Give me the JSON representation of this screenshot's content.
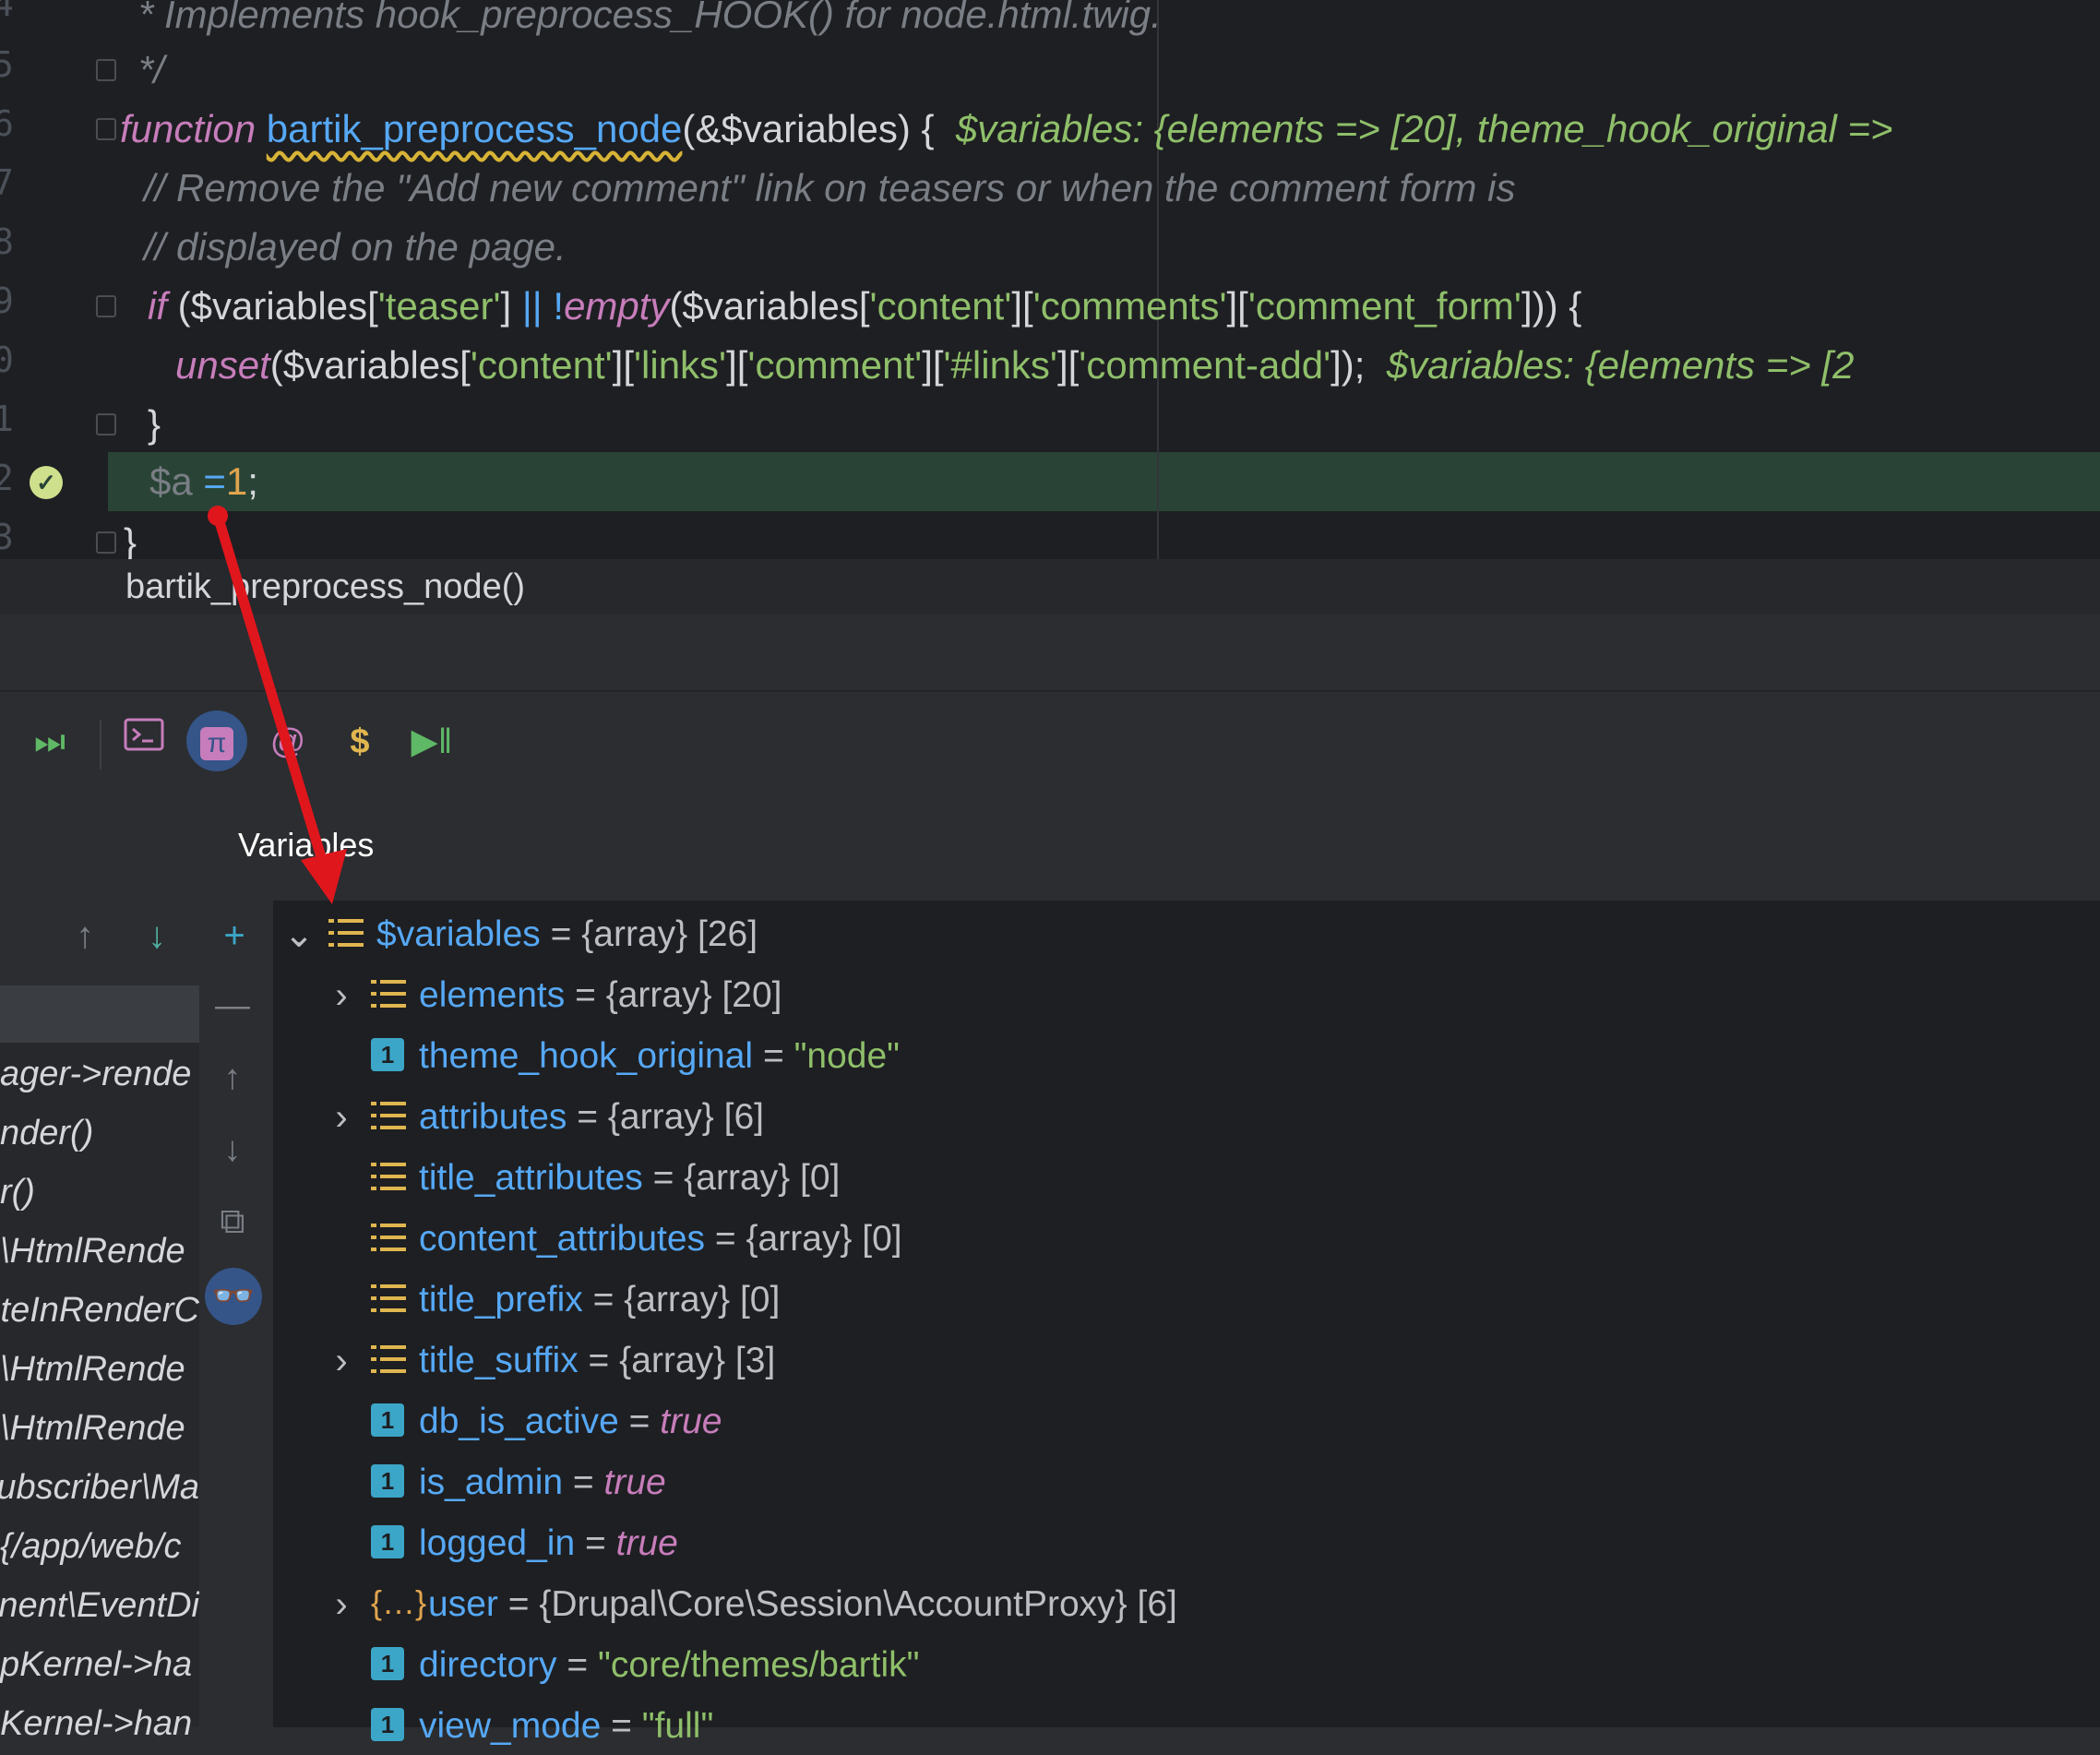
{
  "editor": {
    "line_numbers": [
      "4",
      "5",
      "6",
      "7",
      "8",
      "9",
      "0",
      "1",
      "2",
      "3"
    ],
    "lines": {
      "l1_comment": "* Implements hook_preprocess_HOOK() for node.html.twig.",
      "l2_comment": "*/",
      "l3_kw": "function",
      "l3_fn": "bartik_preprocess_node",
      "l3_args": "(&$variables) {",
      "l3_inline": "$variables: {elements => [20], theme_hook_original =>",
      "l4_comment": "// Remove the \"Add new comment\" link on teasers or when the comment form is",
      "l5_comment": "// displayed on the page.",
      "l6_if": "if",
      "l6_a": " ($variables[",
      "l6_s1": "'teaser'",
      "l6_b": "] ",
      "l6_or": "||",
      "l6_c": " !",
      "l6_empty": "empty",
      "l6_d": "($variables[",
      "l6_s2": "'content'",
      "l6_e": "][",
      "l6_s3": "'comments'",
      "l6_f": "][",
      "l6_s4": "'comment_form'",
      "l6_g": "])) {",
      "l7_unset": "unset",
      "l7_a": "($variables[",
      "l7_s1": "'content'",
      "l7_b": "][",
      "l7_s2": "'links'",
      "l7_c": "][",
      "l7_s3": "'comment'",
      "l7_d": "][",
      "l7_s4": "'#links'",
      "l7_e": "][",
      "l7_s5": "'comment-add'",
      "l7_f": "]);",
      "l7_inline": "$variables: {elements => [2",
      "l8": "}",
      "l9_var": "$a",
      "l9_eq": " =",
      "l9_num": "1",
      "l9_semi": ";",
      "l10": "}"
    },
    "breadcrumb": "bartik_preprocess_node()"
  },
  "toolbar": {
    "icons": [
      "resume-icon",
      "console-icon",
      "php-icon",
      "at-icon",
      "dollar-icon",
      "step-resume-icon"
    ],
    "php_label": "π"
  },
  "variables_panel": {
    "title": "Variables",
    "root": {
      "name": "$variables",
      "eq": "=",
      "type": "{array} [26]"
    },
    "items": [
      {
        "name": "elements",
        "eq": "=",
        "value": "{array} [20]",
        "kind": "array",
        "expandable": true
      },
      {
        "name": "theme_hook_original",
        "eq": "=",
        "value": "\"node\"",
        "kind": "string",
        "expandable": false
      },
      {
        "name": "attributes",
        "eq": "=",
        "value": "{array} [6]",
        "kind": "array",
        "expandable": true
      },
      {
        "name": "title_attributes",
        "eq": "=",
        "value": "{array} [0]",
        "kind": "array",
        "expandable": false
      },
      {
        "name": "content_attributes",
        "eq": "=",
        "value": "{array} [0]",
        "kind": "array",
        "expandable": false
      },
      {
        "name": "title_prefix",
        "eq": "=",
        "value": "{array} [0]",
        "kind": "array",
        "expandable": false
      },
      {
        "name": "title_suffix",
        "eq": "=",
        "value": "{array} [3]",
        "kind": "array",
        "expandable": true
      },
      {
        "name": "db_is_active",
        "eq": "=",
        "value": "true",
        "kind": "bool",
        "expandable": false
      },
      {
        "name": "is_admin",
        "eq": "=",
        "value": "true",
        "kind": "bool",
        "expandable": false
      },
      {
        "name": "logged_in",
        "eq": "=",
        "value": "true",
        "kind": "bool",
        "expandable": false
      },
      {
        "name": "user",
        "eq": "=",
        "value": "{Drupal\\Core\\Session\\AccountProxy} [6]",
        "kind": "object",
        "expandable": true
      },
      {
        "name": "directory",
        "eq": "=",
        "value": "\"core/themes/bartik\"",
        "kind": "string",
        "expandable": false
      },
      {
        "name": "view_mode",
        "eq": "=",
        "value": "\"full\"",
        "kind": "string",
        "expandable": false
      }
    ]
  },
  "frames": [
    "ager->rende",
    "nder()",
    "r()",
    "\\HtmlRende",
    "uteInRenderC",
    "\\HtmlRende",
    "\\HtmlRende",
    "ubscriber\\Ma",
    "{/app/web/c",
    "nent\\EventDi",
    "pKernel->ha",
    "Kernel->han"
  ],
  "colors": {
    "editor_bg": "#1e1f22",
    "exec_line": "#294436",
    "accent_blue": "#56a8f5",
    "string_green": "#8fbf6a",
    "keyword_purple": "#c77dbb",
    "arrow_red": "#e0161d"
  }
}
